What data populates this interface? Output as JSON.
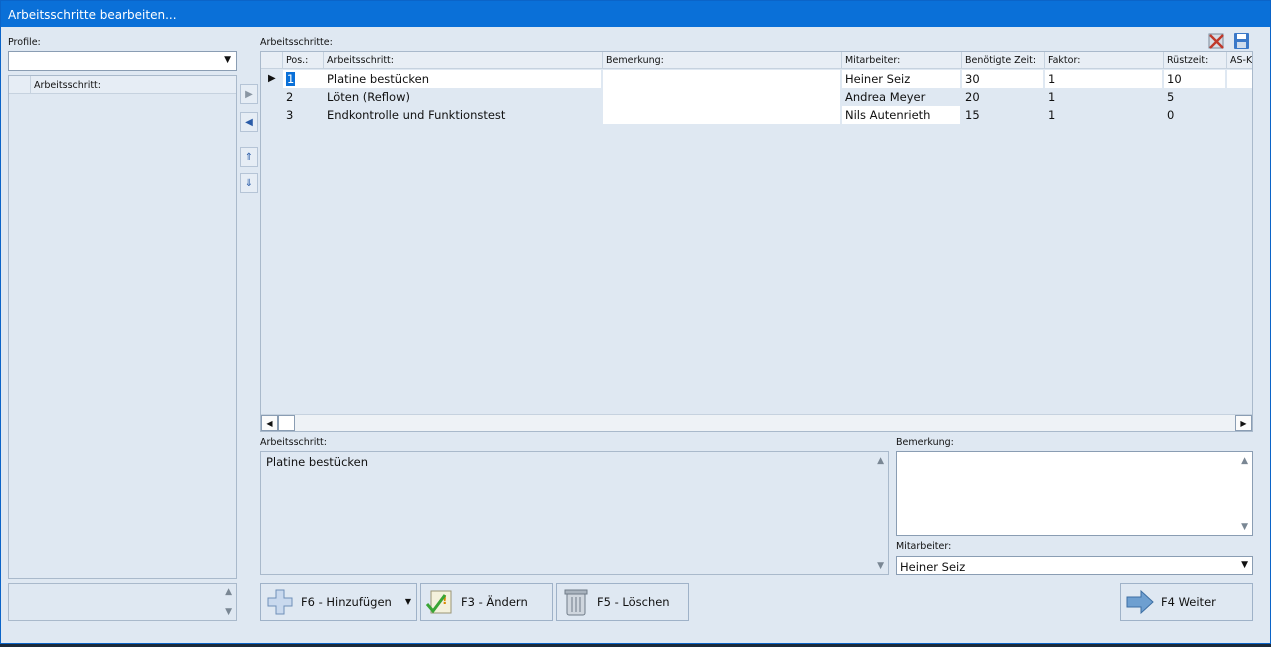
{
  "window": {
    "title": "Arbeitsschritte bearbeiten..."
  },
  "left": {
    "profile_label": "Profile:",
    "profile_value": "",
    "list_header": "Arbeitsschritt:"
  },
  "grid": {
    "label": "Arbeitsschritte:",
    "columns": [
      "Pos.:",
      "Arbeitsschritt:",
      "Bemerkung:",
      "Mitarbeiter:",
      "Benötigte Zeit:",
      "Faktor:",
      "Rüstzeit:",
      "AS-K"
    ],
    "rows": [
      {
        "pos": "1",
        "schritt": "Platine bestücken",
        "bemerkung": "",
        "mitarbeiter": "Heiner Seiz",
        "zeit": "30",
        "faktor": "1",
        "ruestzeit": "10",
        "selected": true
      },
      {
        "pos": "2",
        "schritt": "Löten (Reflow)",
        "bemerkung": "",
        "mitarbeiter": "Andrea Meyer",
        "zeit": "20",
        "faktor": "1",
        "ruestzeit": "5"
      },
      {
        "pos": "3",
        "schritt": "Endkontrolle und Funktionstest",
        "bemerkung": "",
        "mitarbeiter": "Nils Autenrieth",
        "zeit": "15",
        "faktor": "1",
        "ruestzeit": "0"
      }
    ]
  },
  "detail": {
    "schritt_label": "Arbeitsschritt:",
    "schritt_value": "Platine bestücken",
    "bemerkung_label": "Bemerkung:",
    "bemerkung_value": "",
    "mitarbeiter_label": "Mitarbeiter:",
    "mitarbeiter_value": "Heiner Seiz"
  },
  "buttons": {
    "add": "F6 - Hinzufügen",
    "edit": "F3 - Ändern",
    "delete": "F5 - Löschen",
    "next": "F4 Weiter"
  },
  "colors": {
    "titlebar": "#0a70d8",
    "accent_icon": "#2a5ca8",
    "delete_icon": "#c0392b"
  }
}
